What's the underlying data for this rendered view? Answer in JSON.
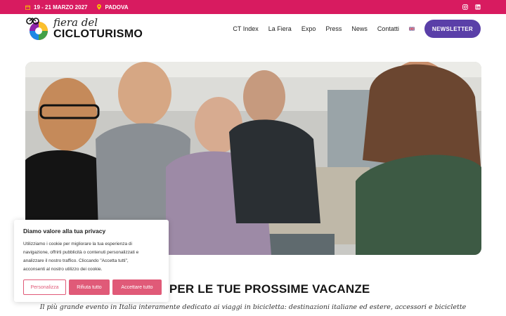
{
  "topbar": {
    "date": "19 - 21 MARZO 2027",
    "city": "PADOVA",
    "bg_color": "#d81b60",
    "icons": [
      "calendar-icon",
      "location-pin-icon",
      "instagram-icon",
      "linkedin-icon"
    ]
  },
  "header": {
    "logo_top": "fiera del",
    "logo_bottom": "CICLOTURISMO",
    "nav": [
      "CT Index",
      "La Fiera",
      "Expo",
      "Press",
      "News",
      "Contatti"
    ],
    "language_flag": "uk-flag-icon",
    "newsletter": "NEWSLETTER",
    "newsletter_color": "#5a3fa8"
  },
  "hero": {
    "image": "people-browsing-books-at-fair-photo"
  },
  "main": {
    "headline": "IONE PER LE TUE PROSSIME VACANZE",
    "subtitle": "Il più grande evento in Italia interamente dedicato ai viaggi in bicicletta: destinazioni italiane ed estere, accessori e biciclette"
  },
  "cookie": {
    "title": "Diamo valore alla tua privacy",
    "text_lines": [
      "Utilizziamo i cookie per migliorare la tua esperienza di",
      "navigazione, offrirti pubblicità o contenuti personalizzati e",
      "analizzare il nostro traffico. Cliccando \"Accetta tutti\",",
      "acconsenti al nostro utilizzo dei cookie."
    ],
    "customize": "Personalizza",
    "reject": "Rifiuta tutto",
    "accept": "Accettare tutto",
    "accent_color": "#e05a78"
  }
}
